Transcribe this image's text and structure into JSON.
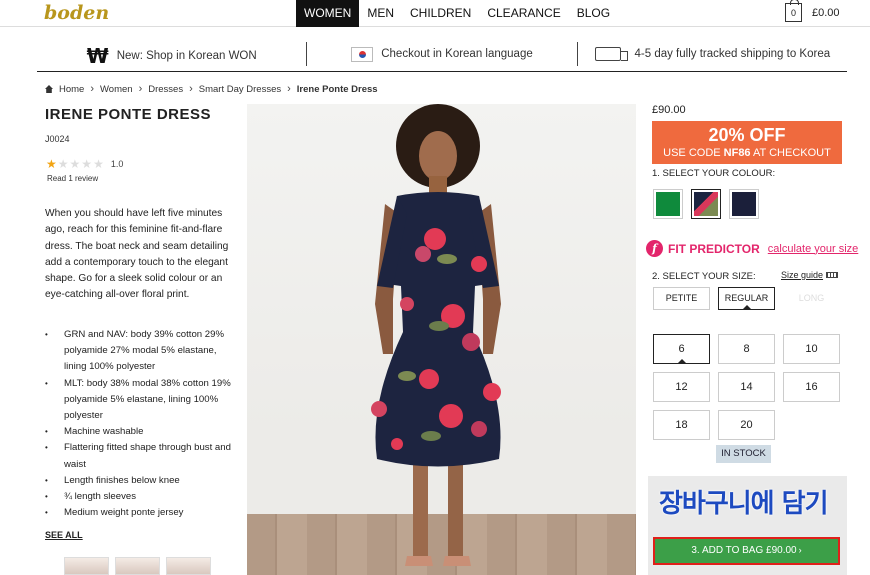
{
  "header": {
    "logo_text": "boden",
    "nav": [
      "WOMEN",
      "MEN",
      "CHILDREN",
      "CLEARANCE",
      "BLOG"
    ],
    "active_nav": "WOMEN",
    "cart_count": "0",
    "cart_total": "£0.00"
  },
  "strip": {
    "won_symbol": "₩",
    "shop_won": "New: Shop in Korean WON",
    "checkout_korean": "Checkout in Korean language",
    "shipping": "4-5 day fully tracked shipping to Korea"
  },
  "breadcrumb": [
    "Home",
    "Women",
    "Dresses",
    "Smart Day Dresses",
    "Irene Ponte Dress"
  ],
  "product": {
    "title": "IRENE PONTE DRESS",
    "sku": "J0024",
    "rating": "1.0",
    "rating_stars": 1,
    "reviews": "Read 1 review",
    "description": "When you should have left five minutes ago, reach for this feminine fit-and-flare dress. The boat neck and seam detailing add a contemporary touch to the elegant shape. Go for a sleek solid colour or an eye-catching all-over floral print.",
    "features": [
      "GRN and NAV: body 39% cotton 29% polyamide 27% modal 5% elastane, lining 100% polyester",
      "MLT: body 38% modal 38% cotton 19% polyamide 5% elastane, lining 100% polyester",
      "Machine washable",
      "Flattering fitted shape through bust and waist",
      "Length finishes below knee",
      "¾ length sleeves",
      "Medium weight ponte jersey"
    ],
    "see_all": "SEE ALL"
  },
  "purchase": {
    "price": "£90.00",
    "promo_big": "20% OFF",
    "promo_prefix": "USE CODE ",
    "promo_code": "NF86",
    "promo_suffix": " AT CHECKOUT",
    "colour_label": "1. SELECT YOUR COLOUR:",
    "colours": [
      {
        "name": "green",
        "hex": "#0f8a3c"
      },
      {
        "name": "floral-navy",
        "hex": "#1c2440"
      },
      {
        "name": "navy",
        "hex": "#1b1f3a"
      }
    ],
    "selected_colour": 1,
    "fit_title": "FIT PREDICTOR",
    "fit_link": "calculate your size",
    "size_label": "2. SELECT YOUR SIZE:",
    "size_guide": "Size guide",
    "fits": [
      {
        "label": "PETITE",
        "state": "normal"
      },
      {
        "label": "REGULAR",
        "state": "selected"
      },
      {
        "label": "LONG",
        "state": "disabled"
      }
    ],
    "sizes": [
      "6",
      "8",
      "10",
      "12",
      "14",
      "16",
      "18",
      "20"
    ],
    "selected_size": "6",
    "stock": "IN STOCK",
    "overlay_korean": "장바구니에 담기",
    "add_to_bag": "3. ADD TO BAG £90.00"
  },
  "colors": {
    "accent_orange": "#ef6a3e",
    "fit_pink": "#e3256b",
    "add_green": "#3c9f48",
    "highlight_red": "#e0201a"
  }
}
